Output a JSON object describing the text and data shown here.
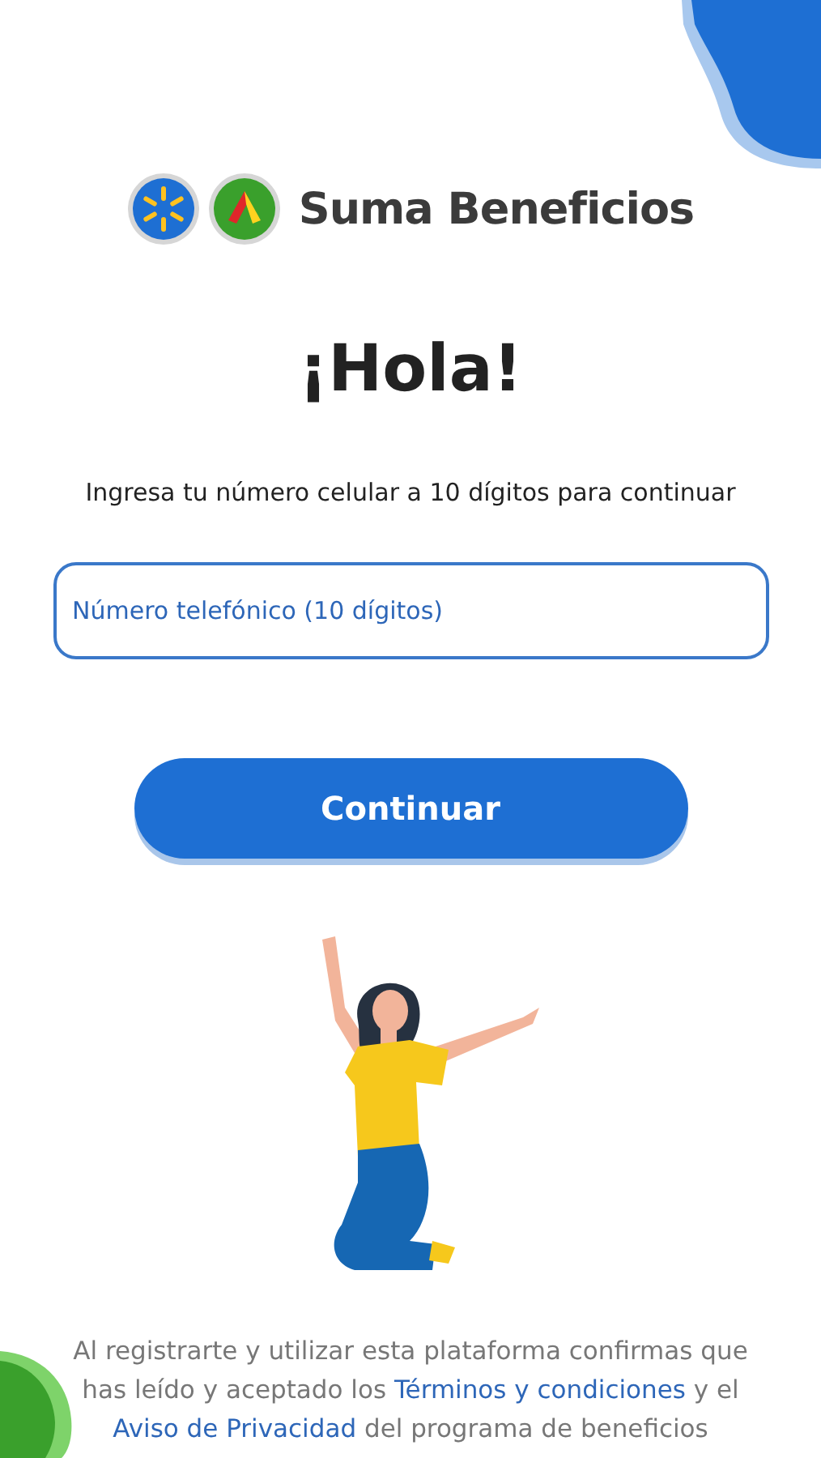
{
  "brand": {
    "name": "Suma Beneficios"
  },
  "greeting": "¡Hola!",
  "instruction": "Ingresa tu número celular a 10 dígitos para continuar",
  "phone_field": {
    "placeholder": "Número telefónico (10 dígitos)"
  },
  "continue_button": "Continuar",
  "footer": [
    {
      "kind": "plain",
      "text": "Al registrarte y utilizar esta plataforma confirmas que has leído y aceptado los "
    },
    {
      "kind": "link",
      "text": "Términos y condiciones"
    },
    {
      "kind": "plain",
      "text": " y el "
    },
    {
      "kind": "link",
      "text": "Aviso de Privacidad"
    },
    {
      "kind": "plain",
      "text": " del programa de beneficios"
    }
  ]
}
